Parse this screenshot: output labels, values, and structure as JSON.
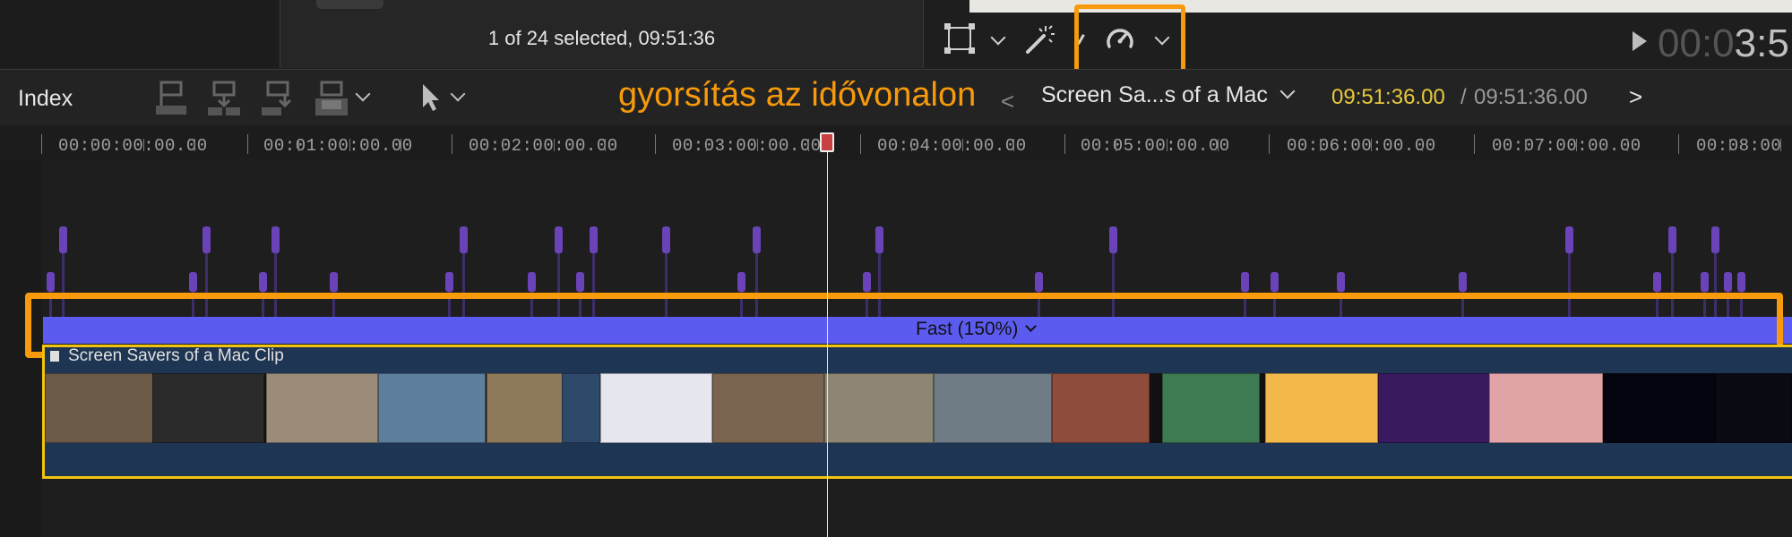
{
  "browser": {
    "selection_info": "1 of 24 selected, 09:51:36"
  },
  "viewer": {
    "timecode_dim": "00:0",
    "timecode_lit": "3:5",
    "icons": [
      "transform-icon",
      "magic-wand-icon",
      "retime-speedometer-icon",
      "play-icon"
    ]
  },
  "timeline_header": {
    "index_label": "Index",
    "annotation": "gyorsítás az idővonalon",
    "project_name": "Screen Sa...s of a Mac",
    "timecode_current": "09:51:36.00",
    "timecode_separator": "/",
    "timecode_total": "09:51:36.00",
    "nav_back": "<",
    "nav_forward": ">"
  },
  "ruler": {
    "labels": [
      "00:00:00:00.00",
      "00:01:00:00.00",
      "00:02:00:00.00",
      "00:03:00:00.00",
      "00:04:00:00.00",
      "00:05:00:00.00",
      "00:06:00:00.00",
      "00:07:00:00.00",
      "00:08:00"
    ]
  },
  "retime": {
    "speed_label": "Fast (150%)"
  },
  "clip": {
    "name": "Screen Savers of a Mac Clip"
  },
  "colors": {
    "accent_orange": "#f79a0c",
    "speed_bar": "#5c5bf0",
    "clip_border": "#f1c40f",
    "clip_body": "#1f3554",
    "timecode_yellow": "#e8c93a",
    "marker_purple": "#6a43b8"
  }
}
